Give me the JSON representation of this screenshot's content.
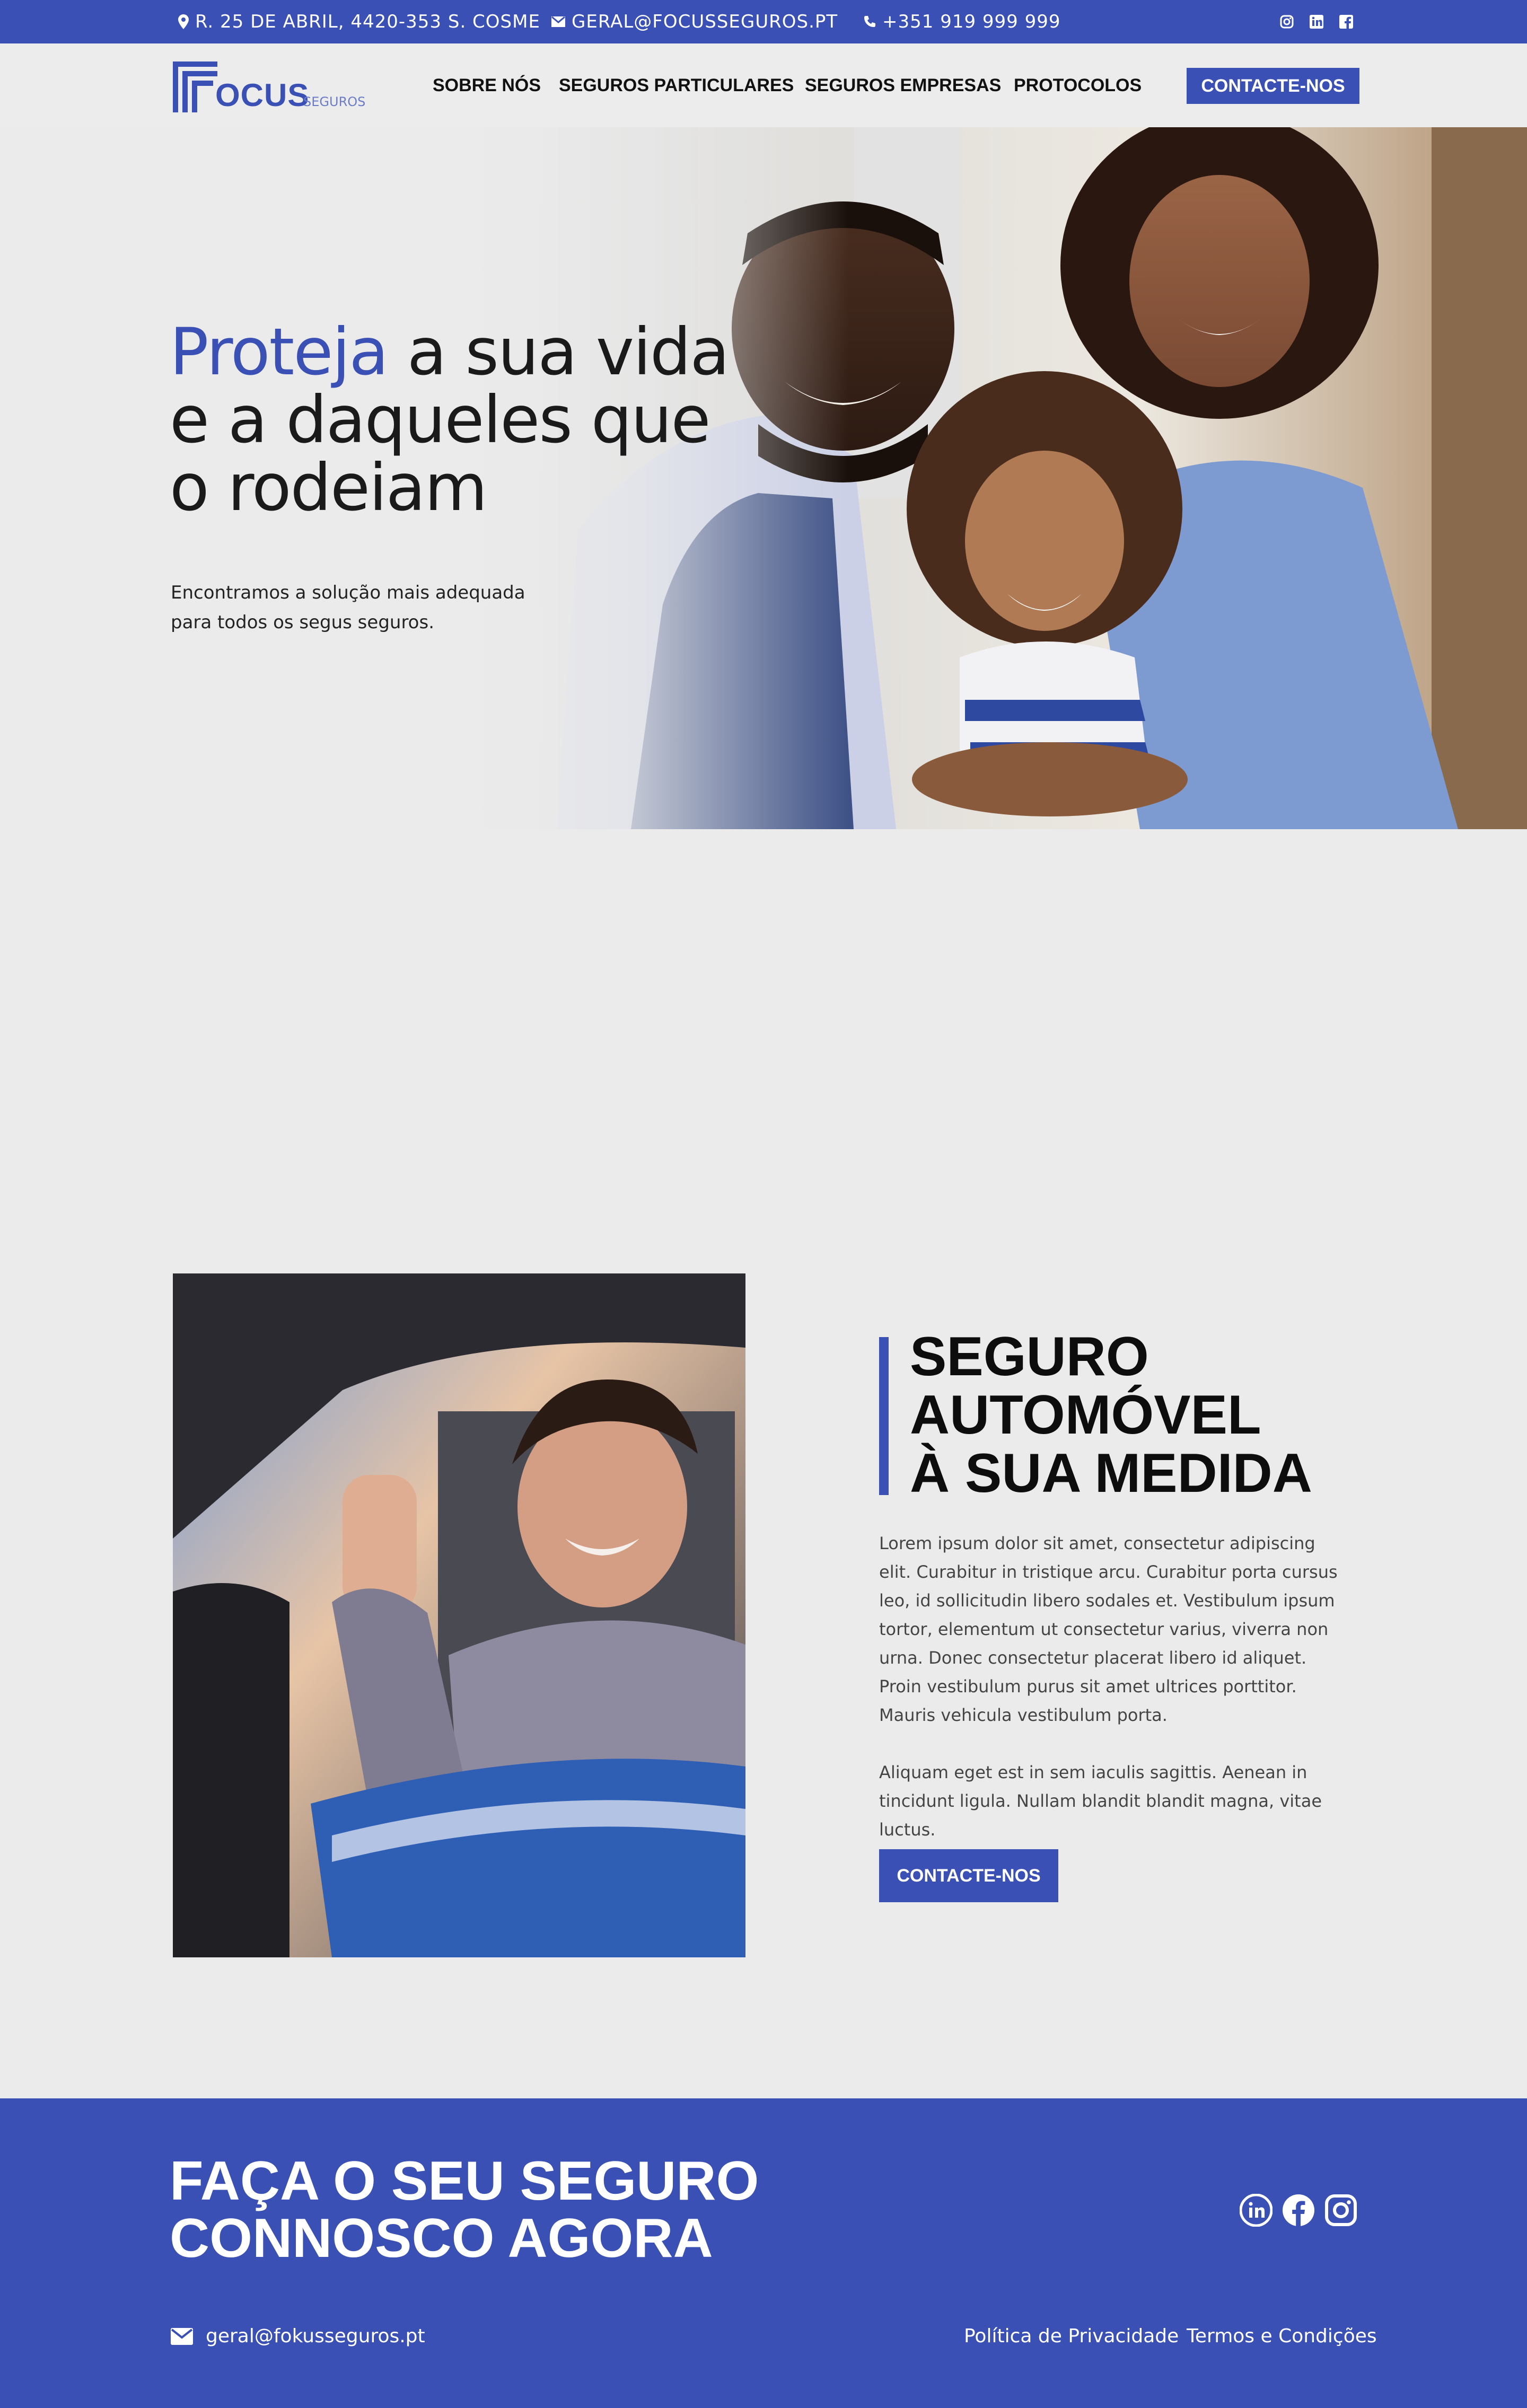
{
  "topbar": {
    "address": "R. 25 DE ABRIL, 4420-353 S. COSME",
    "email": "GERAL@FOCUSSEGUROS.PT",
    "phone": "+351 919 999 999",
    "social_icons": [
      "instagram-icon",
      "linkedin-icon",
      "facebook-icon"
    ]
  },
  "nav": {
    "logo_main": "OCUS",
    "logo_sub": "SEGUROS",
    "items": [
      "SOBRE NÓS",
      "SEGUROS PARTICULARES",
      "SEGUROS EMPRESAS",
      "PROTOCOLOS"
    ],
    "cta": "CONTACTE-NOS"
  },
  "hero": {
    "title_accent": "Proteja",
    "title_line1_rest": " a sua vida",
    "title_line2": "e a daqueles que",
    "title_line3": "o rodeiam",
    "subtitle_line1": "Encontramos a solução mais adequada",
    "subtitle_line2": "para todos os segus seguros."
  },
  "feature": {
    "title_line1": "SEGURO",
    "title_line2": "AUTOMÓVEL",
    "title_line3": "À SUA MEDIDA",
    "paragraph1": "Lorem ipsum dolor sit amet, consectetur adipiscing elit. Curabitur in tristique arcu. Curabitur porta cursus leo, id sollicitudin libero sodales et. Vestibulum ipsum tortor, elementum ut consectetur varius, viverra non urna. Donec consectetur placerat libero id aliquet. Proin vestibulum purus sit amet ultrices porttitor. Mauris vehicula vestibulum porta.",
    "paragraph2": "Aliquam eget est in sem iaculis sagittis. Aenean in tincidunt ligula. Nullam blandit blandit magna, vitae luctus.",
    "cta": "CONTACTE-NOS"
  },
  "footer": {
    "title_line1": "FAÇA O SEU SEGURO",
    "title_line2": "CONNOSCO AGORA",
    "email": "geral@fokusseguros.pt",
    "privacy": "Política de Privacidade",
    "terms": "Termos e Condições",
    "social_icons": [
      "linkedin-icon",
      "facebook-icon",
      "instagram-icon"
    ]
  },
  "colors": {
    "brand": "#3a50b4",
    "page_bg": "#ebebeb",
    "text": "#111111"
  }
}
